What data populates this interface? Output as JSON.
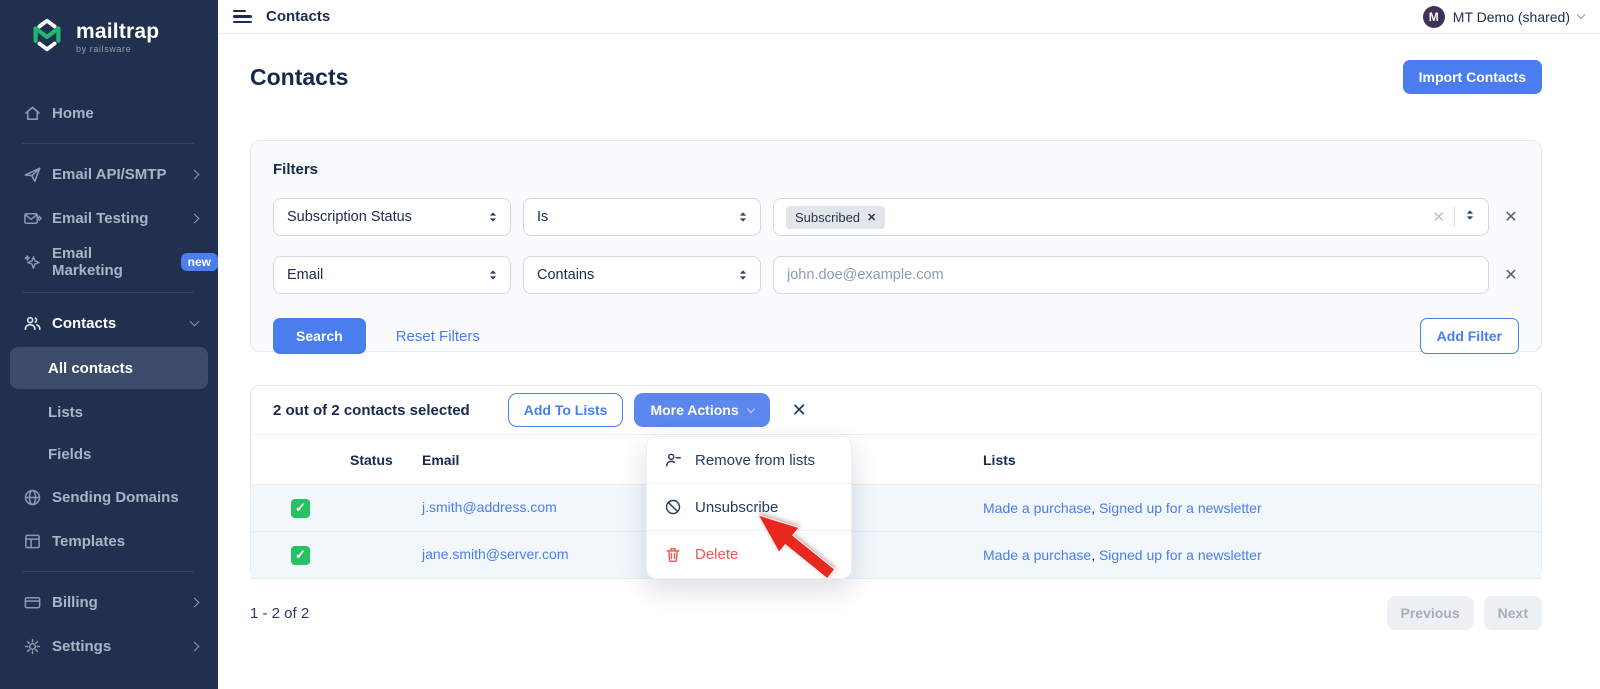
{
  "colors": {
    "primary_blue": "#4a7dee",
    "more_actions_blue": "#5b87ee",
    "sidebar_navy": "#20304e",
    "success_green": "#27c163",
    "danger_red": "#ee5a4e",
    "arrow_red": "#e8281e",
    "row_highlight": "#f2f7fc"
  },
  "sidebar": {
    "logo_name": "mailtrap",
    "logo_byline": "by railsware",
    "home": "Home",
    "email_api": "Email API/SMTP",
    "email_testing": "Email Testing",
    "email_marketing": "Email Marketing",
    "new_badge": "new",
    "contacts": "Contacts",
    "all_contacts": "All contacts",
    "lists": "Lists",
    "fields": "Fields",
    "sending_domains": "Sending Domains",
    "templates": "Templates",
    "billing": "Billing",
    "settings": "Settings"
  },
  "topbar": {
    "breadcrumb": "Contacts",
    "avatar_initial": "M",
    "account_name": "MT Demo (shared)"
  },
  "page": {
    "title": "Contacts",
    "import_button": "Import Contacts"
  },
  "filters": {
    "title": "Filters",
    "rows": [
      {
        "field": "Subscription Status",
        "operator": "Is",
        "value_chip": "Subscribed"
      },
      {
        "field": "Email",
        "operator": "Contains",
        "placeholder": "john.doe@example.com"
      }
    ],
    "search_button": "Search",
    "reset_link": "Reset Filters",
    "add_filter_button": "Add Filter"
  },
  "selection": {
    "text": "2 out of 2 contacts selected",
    "add_to_lists_button": "Add To Lists",
    "more_actions_button": "More Actions"
  },
  "menu": {
    "items": [
      {
        "label": "Remove from lists"
      },
      {
        "label": "Unsubscribe"
      },
      {
        "label": "Delete"
      }
    ]
  },
  "table": {
    "headers": {
      "status": "Status",
      "email": "Email",
      "lists": "Lists"
    },
    "list_separator": ", ",
    "rows": [
      {
        "email": "j.smith@address.com",
        "lists": [
          "Made a purchase",
          "Signed up for a newsletter"
        ]
      },
      {
        "email": "jane.smith@server.com",
        "lists": [
          "Made a purchase",
          "Signed up for a newsletter"
        ]
      }
    ]
  },
  "pagination": {
    "range": "1 - 2 of 2",
    "previous": "Previous",
    "next": "Next"
  }
}
